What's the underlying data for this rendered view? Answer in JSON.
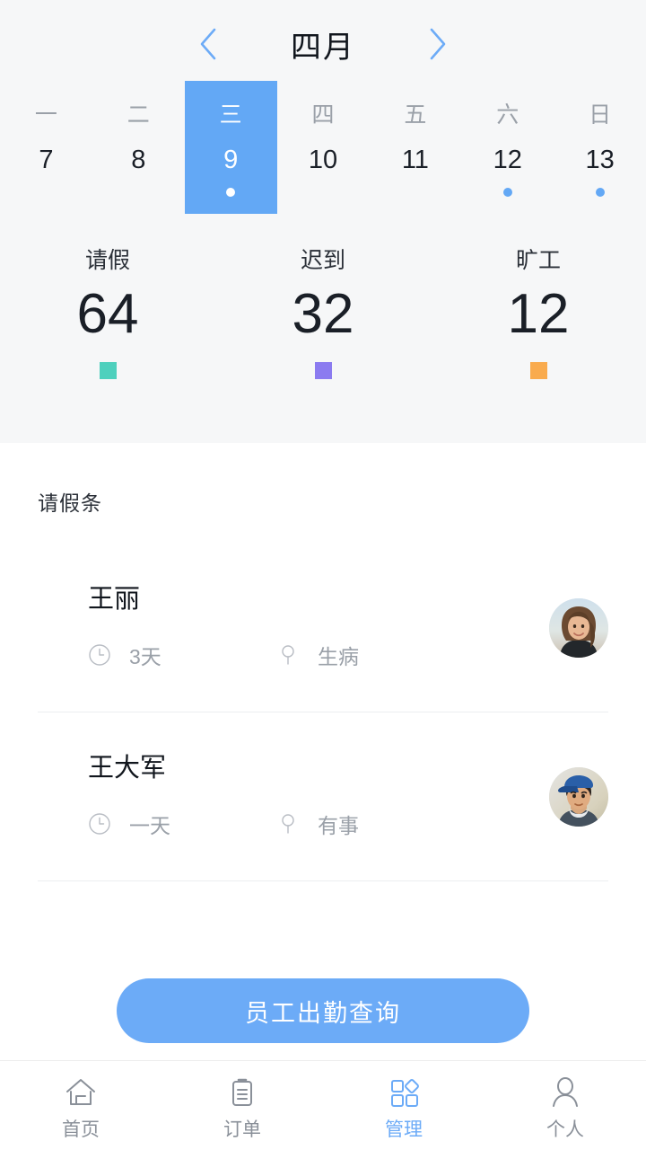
{
  "calendar": {
    "prev_icon": "chevron-left-icon",
    "next_icon": "chevron-right-icon",
    "month": "四月",
    "accent_color": "#63a8f5",
    "days": [
      {
        "dow": "一",
        "num": "7",
        "selected": false,
        "has_event": false
      },
      {
        "dow": "二",
        "num": "8",
        "selected": false,
        "has_event": false
      },
      {
        "dow": "三",
        "num": "9",
        "selected": true,
        "has_event": true
      },
      {
        "dow": "四",
        "num": "10",
        "selected": false,
        "has_event": false
      },
      {
        "dow": "五",
        "num": "11",
        "selected": false,
        "has_event": false
      },
      {
        "dow": "六",
        "num": "12",
        "selected": false,
        "has_event": true
      },
      {
        "dow": "日",
        "num": "13",
        "selected": false,
        "has_event": true
      }
    ]
  },
  "stats": [
    {
      "label": "请假",
      "value": "64",
      "color": "#4ed0bd"
    },
    {
      "label": "迟到",
      "value": "32",
      "color": "#8b7bf0"
    },
    {
      "label": "旷工",
      "value": "12",
      "color": "#f9ab4e"
    }
  ],
  "leave_section": {
    "title": "请假条",
    "items": [
      {
        "name": "王丽",
        "duration": "3天",
        "reason": "生病",
        "duration_icon": "clock-icon",
        "reason_icon": "pin-icon",
        "avatar": "avatar-woman"
      },
      {
        "name": "王大军",
        "duration": "一天",
        "reason": "有事",
        "duration_icon": "clock-icon",
        "reason_icon": "pin-icon",
        "avatar": "avatar-man"
      }
    ]
  },
  "cta": {
    "label": "员工出勤查询",
    "color": "#6cabf7"
  },
  "tabbar": {
    "active_color": "#6cabf7",
    "items": [
      {
        "label": "首页",
        "icon": "home-icon",
        "active": false
      },
      {
        "label": "订单",
        "icon": "clipboard-icon",
        "active": false
      },
      {
        "label": "管理",
        "icon": "grid-icon",
        "active": true
      },
      {
        "label": "个人",
        "icon": "person-icon",
        "active": false
      }
    ]
  }
}
